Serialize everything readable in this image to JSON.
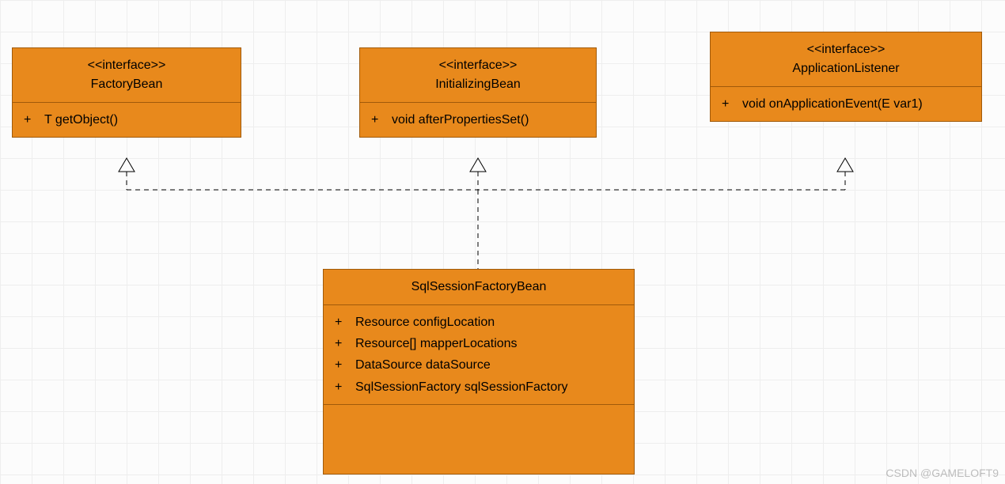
{
  "watermark": "CSDN @GAMELOFT9",
  "interfaces": [
    {
      "stereotype": "<<interface>>",
      "name": "FactoryBean",
      "methods": [
        "T getObject()"
      ]
    },
    {
      "stereotype": "<<interface>>",
      "name": "InitializingBean",
      "methods": [
        "void afterPropertiesSet()"
      ]
    },
    {
      "stereotype": "<<interface>>",
      "name": "ApplicationListener",
      "methods": [
        "void onApplicationEvent(E var1)"
      ]
    }
  ],
  "class": {
    "name": "SqlSessionFactoryBean",
    "attributes": [
      "Resource configLocation",
      "Resource[] mapperLocations",
      "DataSource dataSource",
      "SqlSessionFactory sqlSessionFactory"
    ]
  },
  "chart_data": {
    "type": "uml_class_diagram",
    "nodes": [
      {
        "id": "FactoryBean",
        "kind": "interface",
        "stereotype": "<<interface>>",
        "methods": [
          "+ T getObject()"
        ]
      },
      {
        "id": "InitializingBean",
        "kind": "interface",
        "stereotype": "<<interface>>",
        "methods": [
          "+ void afterPropertiesSet()"
        ]
      },
      {
        "id": "ApplicationListener",
        "kind": "interface",
        "stereotype": "<<interface>>",
        "methods": [
          "+ void onApplicationEvent(E var1)"
        ]
      },
      {
        "id": "SqlSessionFactoryBean",
        "kind": "class",
        "attributes": [
          "+ Resource configLocation",
          "+ Resource[] mapperLocations",
          "+ DataSource dataSource",
          "+ SqlSessionFactory sqlSessionFactory"
        ]
      }
    ],
    "edges": [
      {
        "from": "SqlSessionFactoryBean",
        "to": "FactoryBean",
        "type": "realization"
      },
      {
        "from": "SqlSessionFactoryBean",
        "to": "InitializingBean",
        "type": "realization"
      },
      {
        "from": "SqlSessionFactoryBean",
        "to": "ApplicationListener",
        "type": "realization"
      }
    ]
  }
}
